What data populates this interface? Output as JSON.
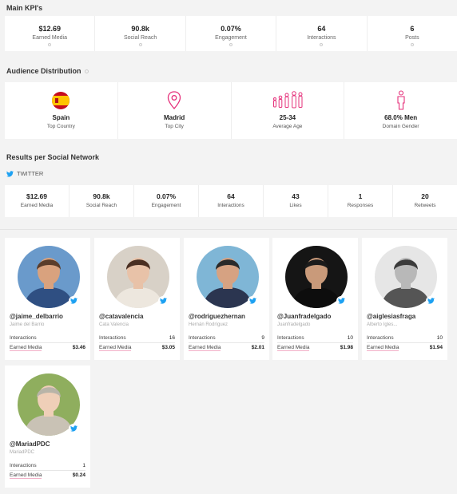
{
  "main_kpis": {
    "title": "Main KPI's",
    "items": [
      {
        "value": "$12.69",
        "label": "Earned Media"
      },
      {
        "value": "90.8k",
        "label": "Social Reach"
      },
      {
        "value": "0.07%",
        "label": "Engagement"
      },
      {
        "value": "64",
        "label": "Interactions"
      },
      {
        "value": "6",
        "label": "Posts"
      }
    ]
  },
  "audience": {
    "title": "Audience Distribution",
    "items": [
      {
        "icon": "spain-flag-icon",
        "value": "Spain",
        "label": "Top Country"
      },
      {
        "icon": "map-pin-icon",
        "value": "Madrid",
        "label": "Top City"
      },
      {
        "icon": "age-group-icon",
        "value": "25-34",
        "label": "Average Age"
      },
      {
        "icon": "man-icon",
        "value": "68.0% Men",
        "label": "Domain Gender"
      }
    ]
  },
  "results": {
    "title": "Results per Social Network",
    "network": "TWITTER",
    "items": [
      {
        "value": "$12.69",
        "label": "Earned Media"
      },
      {
        "value": "90.8k",
        "label": "Social Reach"
      },
      {
        "value": "0.07%",
        "label": "Engagement"
      },
      {
        "value": "64",
        "label": "Interactions"
      },
      {
        "value": "43",
        "label": "Likes"
      },
      {
        "value": "1",
        "label": "Responses"
      },
      {
        "value": "20",
        "label": "Retweets"
      }
    ]
  },
  "influencers": [
    {
      "handle": "@jaime_delbarrio",
      "name": "Jaime del Barrio",
      "interactions_label": "Interactions",
      "interactions": "",
      "earned_label": "Earned Media",
      "earned": "$3.46",
      "bg": "#6a9acb",
      "skin": "#d9a27e",
      "hair": "#5a3d2b",
      "shirt": "#2f4f82"
    },
    {
      "handle": "@catavalencia",
      "name": "Cata Valencia",
      "interactions_label": "Interactions",
      "interactions": "16",
      "earned_label": "Earned Media",
      "earned": "$3.05",
      "bg": "#d8d1c7",
      "skin": "#e8c2a8",
      "hair": "#4a2f22",
      "shirt": "#ede7de"
    },
    {
      "handle": "@rodriguezhernan",
      "name": "Hernán Rodríguez",
      "interactions_label": "Interactions",
      "interactions": "9",
      "earned_label": "Earned Media",
      "earned": "$2.01",
      "bg": "#7fb6d6",
      "skin": "#d6a282",
      "hair": "#2a2a2a",
      "shirt": "#2b3550"
    },
    {
      "handle": "@Juanfradelgado",
      "name": "Juanfradelgado",
      "interactions_label": "Interactions",
      "interactions": "10",
      "earned_label": "Earned Media",
      "earned": "$1.98",
      "bg": "#151515",
      "skin": "#c99a7a",
      "hair": "#1b1b1b",
      "shirt": "#0d0d0d"
    },
    {
      "handle": "@aiglesiasfraga",
      "name": "Alberto Igles...",
      "interactions_label": "Interactions",
      "interactions": "10",
      "earned_label": "Earned Media",
      "earned": "$1.94",
      "bg": "#e6e6e6",
      "skin": "#b8b8b8",
      "hair": "#3a3a3a",
      "shirt": "#555555"
    },
    {
      "handle": "@MariadPDC",
      "name": "MariadPDC",
      "interactions_label": "Interactions",
      "interactions": "1",
      "earned_label": "Earned Media",
      "earned": "$0.24",
      "bg": "#8fae5e",
      "skin": "#efcfb8",
      "hair": "#b8b4a8",
      "shirt": "#c9c2b5"
    }
  ],
  "colors": {
    "accent_pink": "#e5307a",
    "twitter_blue": "#1da1f2"
  }
}
